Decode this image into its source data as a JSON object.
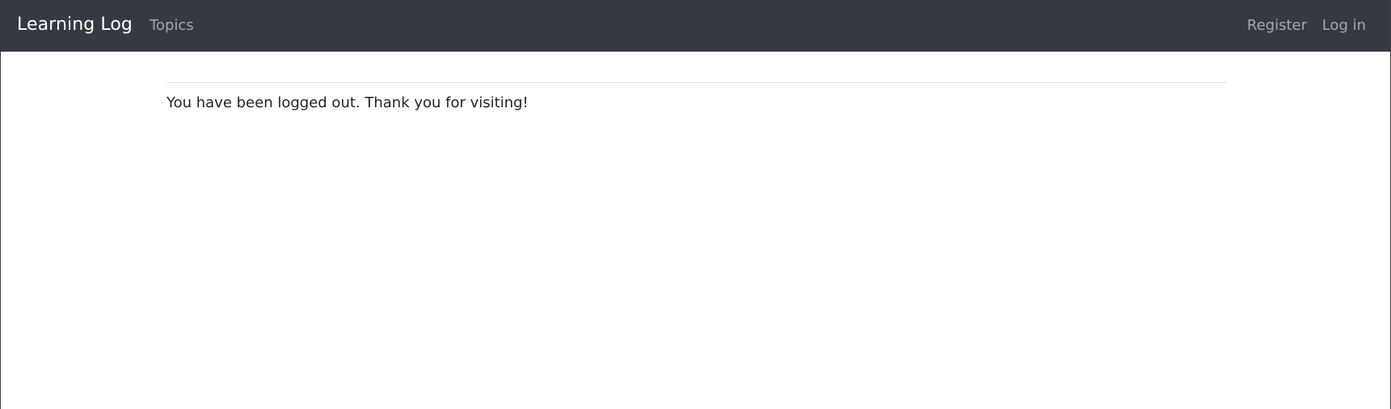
{
  "navbar": {
    "brand": "Learning Log",
    "links": {
      "topics": "Topics",
      "register": "Register",
      "login": "Log in"
    }
  },
  "main": {
    "message": "You have been logged out. Thank you for visiting!"
  },
  "colors": {
    "navbar_background": "#343a40",
    "brand_text": "#ffffff",
    "nav_link_text": "#9a9da0",
    "body_text": "#212529",
    "divider": "#dee2e6"
  }
}
